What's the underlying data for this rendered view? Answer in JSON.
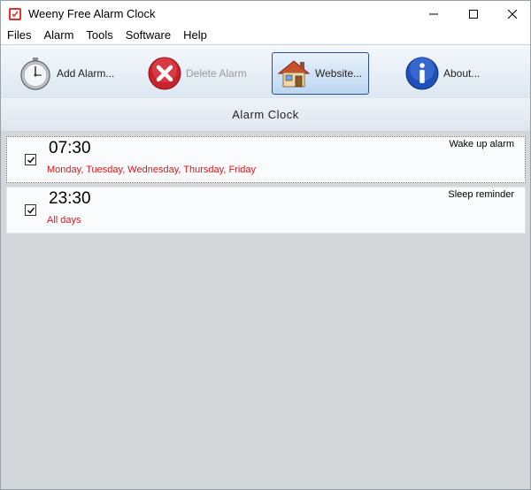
{
  "window": {
    "title": "Weeny Free Alarm Clock"
  },
  "menu": [
    "Files",
    "Alarm",
    "Tools",
    "Software",
    "Help"
  ],
  "toolbar": {
    "add_label": "Add Alarm...",
    "delete_label": "Delete Alarm",
    "website_label": "Website...",
    "about_label": "About..."
  },
  "header": {
    "title": "Alarm Clock"
  },
  "alarms": [
    {
      "time": "07:30",
      "days": "Monday, Tuesday, Wednesday, Thursday, Friday",
      "name": "Wake up alarm",
      "checked": true
    },
    {
      "time": "23:30",
      "days": "All days",
      "name": "Sleep reminder",
      "checked": true
    }
  ],
  "colors": {
    "days_text": "#e0151b",
    "toolbar_active_border": "#2b4f8f"
  },
  "icons": [
    "alarm-clock-app-icon",
    "minimize-icon",
    "maximize-icon",
    "close-icon",
    "stopwatch-icon",
    "delete-x-icon",
    "house-icon",
    "info-icon",
    "checkmark-icon"
  ]
}
